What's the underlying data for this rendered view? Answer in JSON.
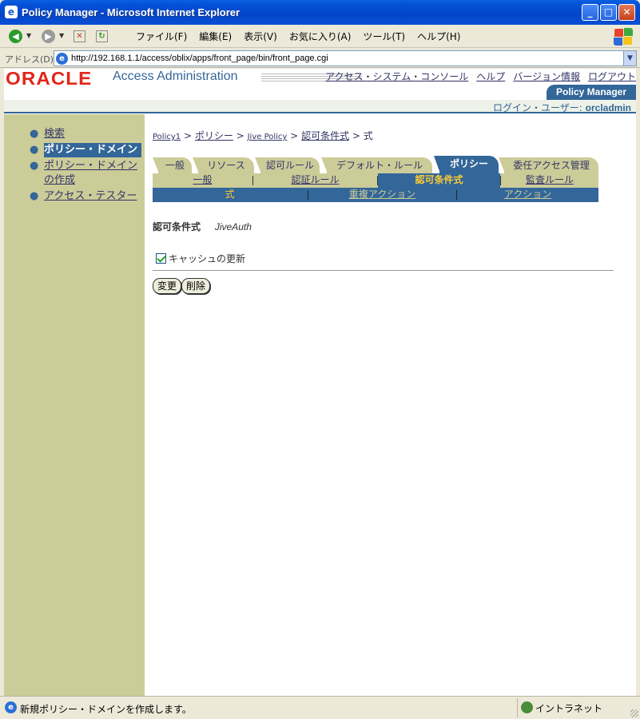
{
  "window": {
    "title": "Policy Manager - Microsoft Internet Explorer",
    "minimize": "_",
    "maximize": "□",
    "close": "✕"
  },
  "menu": [
    "ファイル(F)",
    "編集(E)",
    "表示(V)",
    "お気に入り(A)",
    "ツール(T)",
    "ヘルプ(H)"
  ],
  "address": {
    "label": "アドレス(D)",
    "url": "http://192.168.1.1/access/oblix/apps/front_page/bin/front_page.cgi"
  },
  "header": {
    "logo": "ORACLE",
    "app_title": "Access Administration",
    "links": [
      "アクセス・システム・コンソール",
      "ヘルプ",
      "バージョン情報",
      "ログアウト"
    ],
    "pm_tab": "Policy Manager",
    "login_label": "ログイン・ユーザー: ",
    "login_user": "orcladmin"
  },
  "sidebar": {
    "items": [
      {
        "label": "検索"
      },
      {
        "label": "ポリシー・ドメイン"
      },
      {
        "label": "ポリシー・ドメインの作成"
      },
      {
        "label": "アクセス・テスター"
      }
    ]
  },
  "breadcrumb": {
    "items": [
      "Policy1",
      "ポリシー",
      "Jive Policy",
      "認可条件式"
    ],
    "current": "式",
    "sep": ">"
  },
  "tabs": [
    "一般",
    "リソース",
    "認可ルール",
    "デフォルト・ルール",
    "ポリシー",
    "委任アクセス管理"
  ],
  "subtabs": [
    "一般",
    "認証ルール",
    "認可条件式",
    "監査ルール"
  ],
  "subsubtabs": [
    "式",
    "重複アクション",
    "アクション"
  ],
  "expression": {
    "label": "認可条件式",
    "value": "JiveAuth"
  },
  "cache_label": "キャッシュの更新",
  "buttons": {
    "modify": "変更",
    "delete": "削除"
  },
  "status": {
    "text": "新規ポリシー・ドメインを作成します。",
    "zone": "イントラネット"
  },
  "colors": {
    "oracle_red": "#E2261A",
    "navy": "#336699",
    "khaki": "#CCCC99",
    "highlight": "#FFCC33"
  }
}
